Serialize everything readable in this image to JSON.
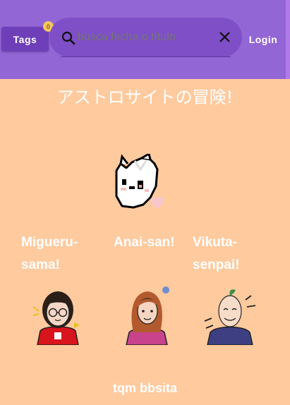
{
  "header": {
    "tags_label": "Tags",
    "tags_badge": "0",
    "search": {
      "placeholder": "busca fecha o título",
      "value": ""
    },
    "login_label": "Login",
    "colors": {
      "bar": "#9366D6",
      "search_bg": "#7E4FC6",
      "tags_bg": "#6E3FB8",
      "badge": "#F3C65E"
    }
  },
  "main": {
    "title": "アストロサイトの冒険!",
    "mascot_icon": "pixel-cat-icon",
    "team": [
      {
        "name": "Migueru-sama!",
        "avatar_icon": "girl-glasses-avatar"
      },
      {
        "name": "Anai-san!",
        "avatar_icon": "girl-long-hair-avatar"
      },
      {
        "name": "Vikuta-senpai!",
        "avatar_icon": "bald-man-avatar"
      }
    ],
    "footer_text": "tqm bbsita"
  },
  "colors": {
    "page_bg": "#FFCA9E"
  }
}
